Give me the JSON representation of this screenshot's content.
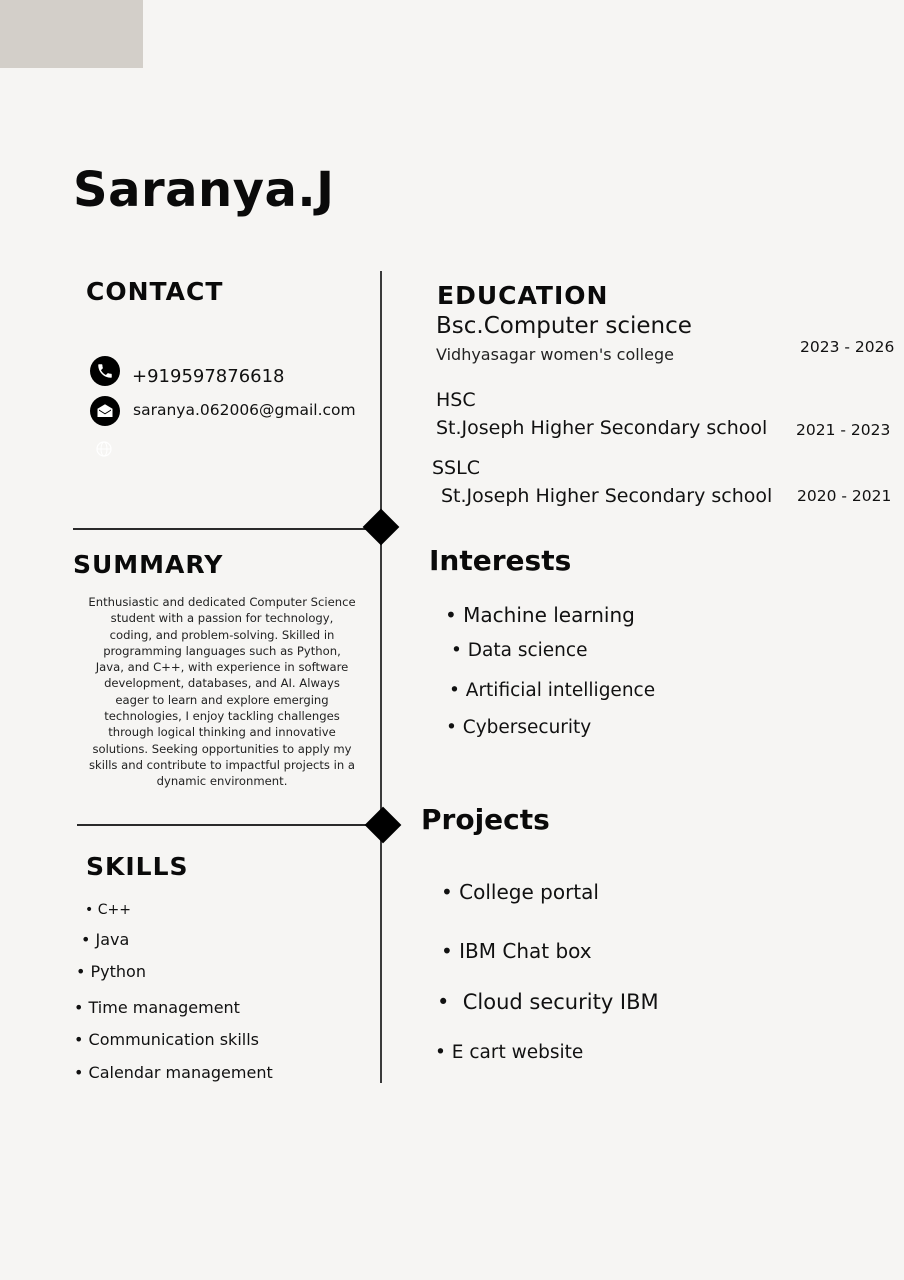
{
  "header": {
    "name": "Saranya.J"
  },
  "contact": {
    "title": "CONTACT",
    "phone": "+919597876618",
    "email": "saranya.062006@gmail.com"
  },
  "summary": {
    "title": "SUMMARY",
    "text": "Enthusiastic and dedicated Computer Science student with a passion for technology, coding, and problem-solving. Skilled in programming languages such as Python, Java, and C++, with experience in software development, databases, and AI. Always eager to learn and explore emerging technologies, I enjoy tackling challenges through logical thinking and innovative solutions. Seeking opportunities to apply my skills and contribute to impactful projects in a dynamic environment."
  },
  "skills": {
    "title": "SKILLS",
    "items": [
      "• C++",
      "• Java",
      "• Python",
      "• Time management",
      "• Communication skills",
      "• Calendar management"
    ]
  },
  "education": {
    "title": "EDUCATION",
    "entries": [
      {
        "degree": "Bsc.Computer science",
        "school": "Vidhyasagar women's college",
        "years": "2023 - 2026"
      },
      {
        "degree": "HSC",
        "school": "St.Joseph Higher Secondary school",
        "years": "2021 - 2023"
      },
      {
        "degree": "SSLC",
        "school": "St.Joseph Higher Secondary school",
        "years": "2020 - 2021"
      }
    ]
  },
  "interests": {
    "title": "Interests",
    "items": [
      "• Machine learning",
      "• Data science",
      "• Artificial intelligence",
      "• Cybersecurity"
    ]
  },
  "projects": {
    "title": "Projects",
    "items": [
      "• College portal",
      "• IBM Chat box",
      "•  Cloud security IBM",
      "• E cart website"
    ]
  },
  "icons": {
    "phone": "phone-icon",
    "email": "email-icon",
    "web": "globe-icon"
  }
}
